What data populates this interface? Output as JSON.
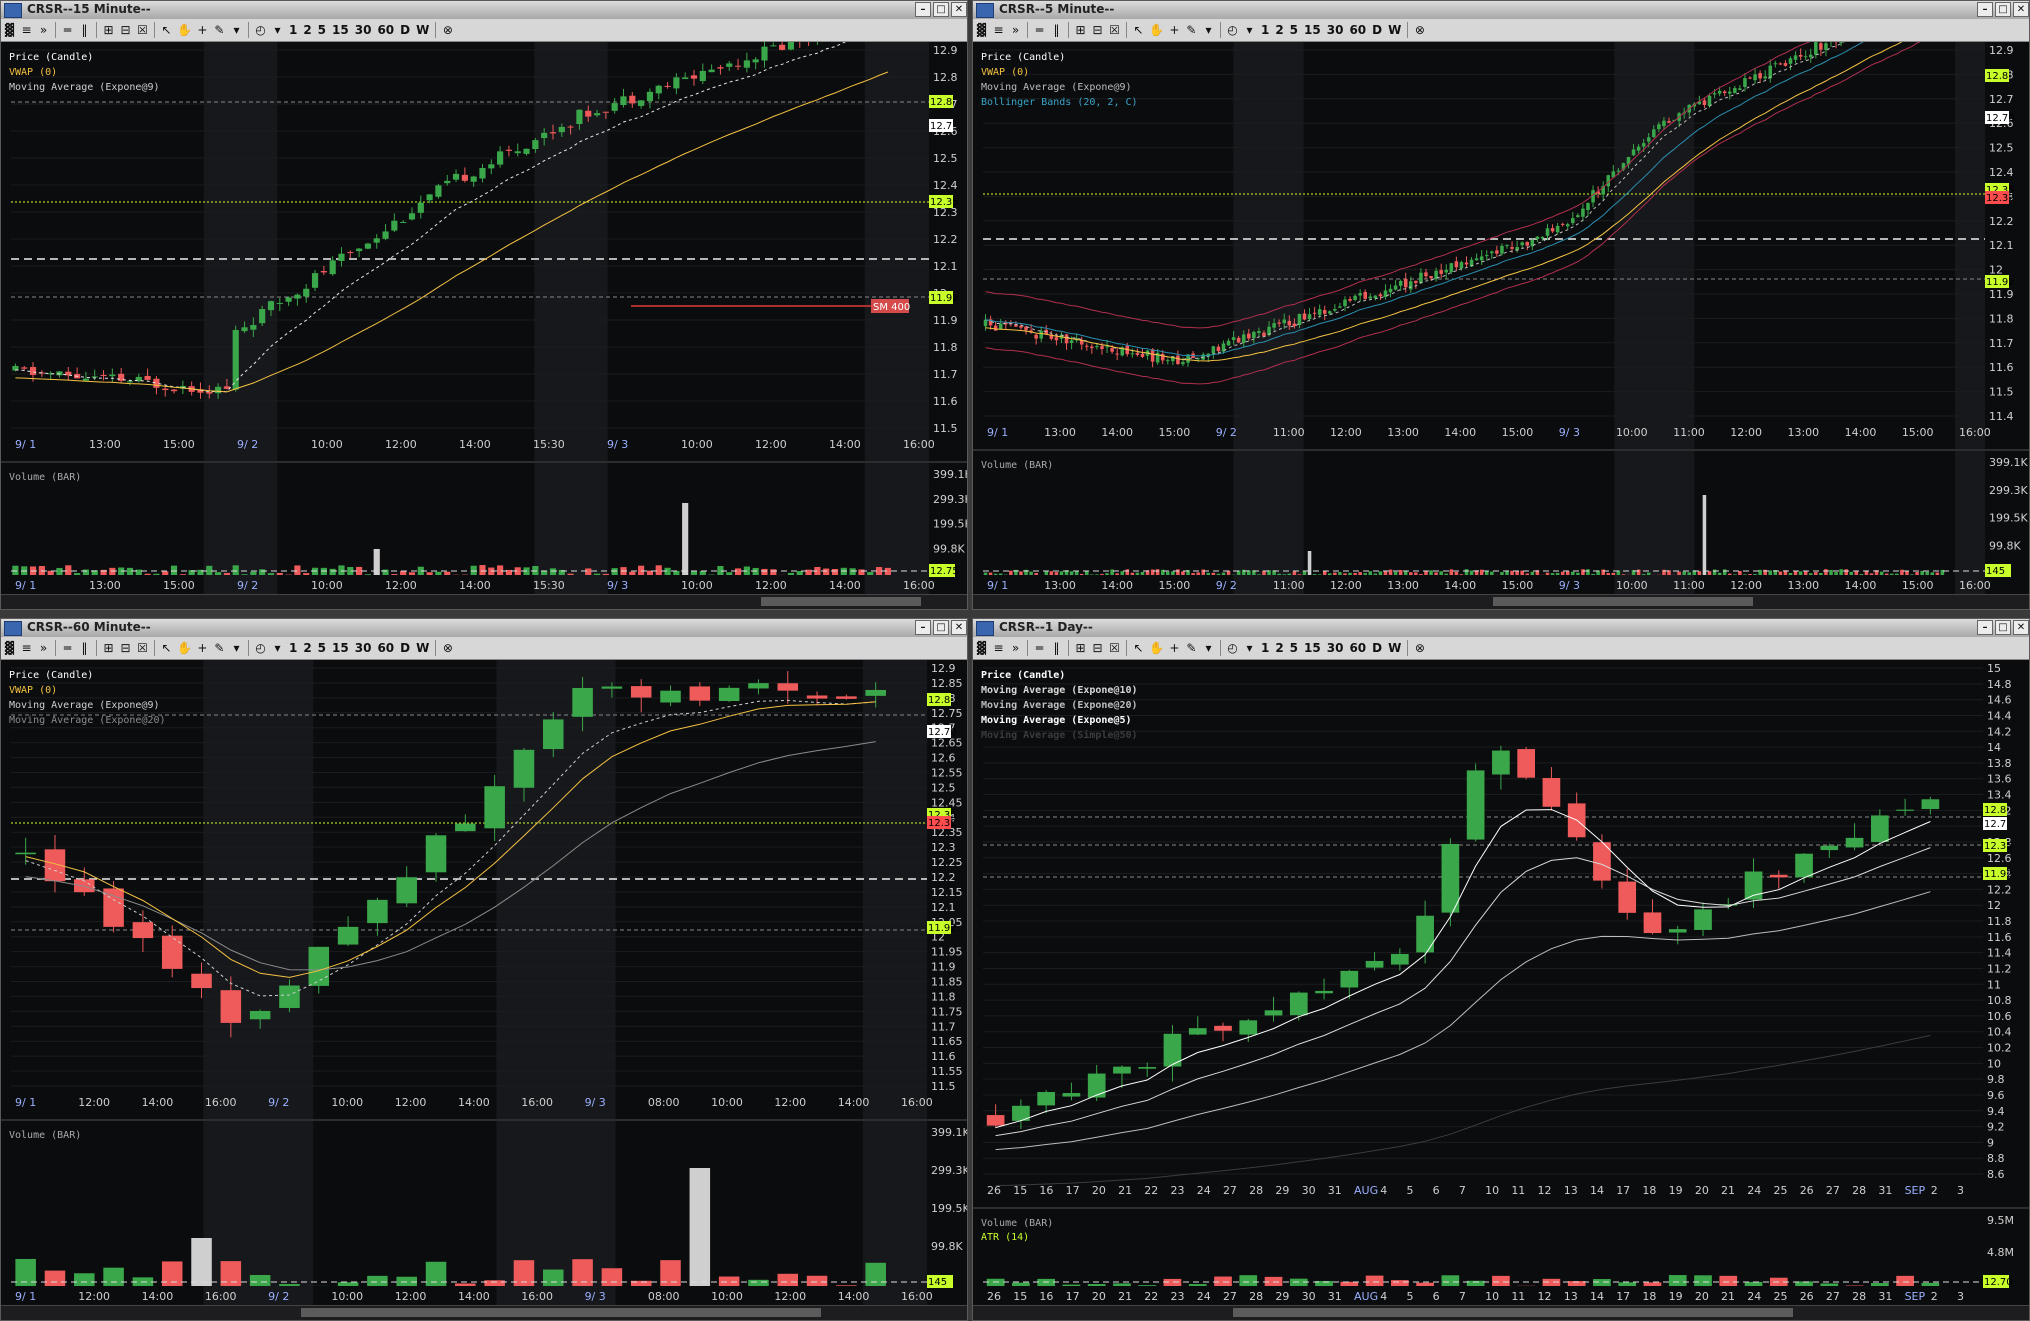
{
  "panels": [
    {
      "id": "p15",
      "title": "CRSR--15 Minute--",
      "legend": [
        {
          "text": "Price (Candle)",
          "color": "#ffffff"
        },
        {
          "text": "VWAP (0)",
          "color": "#f5c242"
        },
        {
          "text": "Moving Average (Expone@9)",
          "color": "#cfcfcf"
        }
      ],
      "price_ticks": [
        "12.9",
        "12.8",
        "12.7",
        "12.6",
        "12.5",
        "12.4",
        "12.3",
        "12.2",
        "12.1",
        "12",
        "11.9",
        "11.8",
        "11.7",
        "11.6",
        "11.5"
      ],
      "price_badges": [
        {
          "text": "12.8",
          "color": "#c8ff2a"
        },
        {
          "text": "12.7",
          "color": "#ffffff"
        },
        {
          "text": "12.35",
          "color": "#c8ff2a"
        },
        {
          "text": "11.92",
          "color": "#c8ff2a"
        }
      ],
      "order_label": "SM 400",
      "time_ticks": [
        "9/ 1",
        "13:00",
        "15:00",
        "9/ 2",
        "10:00",
        "12:00",
        "14:00",
        "15:30",
        "9/ 3",
        "10:00",
        "12:00",
        "14:00",
        "16:00"
      ],
      "volume_label": "Volume (BAR)",
      "volume_ticks": [
        "399.1K",
        "299.3K",
        "199.5K",
        "99.8K"
      ],
      "volume_badge": "12.75"
    },
    {
      "id": "p5",
      "title": "CRSR--5 Minute--",
      "legend": [
        {
          "text": "Price (Candle)",
          "color": "#ffffff"
        },
        {
          "text": "VWAP (0)",
          "color": "#f5c242"
        },
        {
          "text": "Moving Average (Expone@9)",
          "color": "#bdbdbd"
        },
        {
          "text": "Bollinger Bands (20, 2, C)",
          "color": "#3aa5c8"
        }
      ],
      "price_ticks": [
        "12.9",
        "12.8",
        "12.7",
        "12.6",
        "12.5",
        "12.4",
        "12.3",
        "12.2",
        "12.1",
        "12",
        "11.9",
        "11.8",
        "11.7",
        "11.6",
        "11.5",
        "11.4"
      ],
      "price_badges": [
        {
          "text": "12.8",
          "color": "#c8ff2a"
        },
        {
          "text": "12.70",
          "color": "#ffffff"
        },
        {
          "text": "12.35",
          "color": "#c8ff2a"
        },
        {
          "text": "12.32",
          "color": "#ff4d4d"
        },
        {
          "text": "11.92",
          "color": "#c8ff2a"
        }
      ],
      "time_ticks": [
        "9/ 1",
        "13:00",
        "14:00",
        "15:00",
        "9/ 2",
        "11:00",
        "12:00",
        "13:00",
        "14:00",
        "15:00",
        "9/ 3",
        "10:00",
        "11:00",
        "12:00",
        "13:00",
        "14:00",
        "15:00",
        "16:00"
      ],
      "volume_label": "Volume (BAR)",
      "volume_ticks": [
        "399.1K",
        "299.3K",
        "199.5K",
        "99.8K"
      ],
      "volume_badge": "145"
    },
    {
      "id": "p60",
      "title": "CRSR--60 Minute--",
      "legend": [
        {
          "text": "Price (Candle)",
          "color": "#ffffff"
        },
        {
          "text": "VWAP (0)",
          "color": "#f5c242"
        },
        {
          "text": "Moving Average (Expone@9)",
          "color": "#cfcfcf"
        },
        {
          "text": "Moving Average (Expone@20)",
          "color": "#8c8c8c"
        }
      ],
      "price_ticks": [
        "12.9",
        "12.85",
        "12.8",
        "12.75",
        "12.7",
        "12.65",
        "12.6",
        "12.55",
        "12.5",
        "12.45",
        "12.4",
        "12.35",
        "12.3",
        "12.25",
        "12.2",
        "12.15",
        "12.1",
        "12.05",
        "12",
        "11.95",
        "11.9",
        "11.85",
        "11.8",
        "11.75",
        "11.7",
        "11.65",
        "11.6",
        "11.55",
        "11.5"
      ],
      "price_badges": [
        {
          "text": "12.8",
          "color": "#c8ff2a"
        },
        {
          "text": "12.70",
          "color": "#ffffff"
        },
        {
          "text": "12.35",
          "color": "#c8ff2a"
        },
        {
          "text": "12.32",
          "color": "#ff4d4d"
        },
        {
          "text": "11.92",
          "color": "#c8ff2a"
        }
      ],
      "time_ticks": [
        "9/ 1",
        "12:00",
        "14:00",
        "16:00",
        "9/ 2",
        "10:00",
        "12:00",
        "14:00",
        "16:00",
        "9/ 3",
        "08:00",
        "10:00",
        "12:00",
        "14:00",
        "16:00"
      ],
      "volume_label": "Volume (BAR)",
      "volume_ticks": [
        "399.1K",
        "299.3K",
        "199.5K",
        "99.8K"
      ],
      "volume_badge": "145"
    },
    {
      "id": "p1d",
      "title": "CRSR--1 Day--",
      "legend": [
        {
          "text": "Price (Candle)",
          "color": "#ffffff"
        },
        {
          "text": "Moving Average (Expone@10)",
          "color": "#d8d8d8"
        },
        {
          "text": "Moving Average (Expone@20)",
          "color": "#bdbdbd"
        },
        {
          "text": "Moving Average (Expone@5)",
          "color": "#ffffff"
        },
        {
          "text": "Moving Average (Simple@50)",
          "color": "#3c3c3c"
        }
      ],
      "price_ticks": [
        "15",
        "14.8",
        "14.6",
        "14.4",
        "14.2",
        "14",
        "13.8",
        "13.6",
        "13.4",
        "13.2",
        "13",
        "12.8",
        "12.6",
        "12.4",
        "12.2",
        "12",
        "11.8",
        "11.6",
        "11.4",
        "11.2",
        "11",
        "10.8",
        "10.6",
        "10.4",
        "10.2",
        "10",
        "9.8",
        "9.6",
        "9.4",
        "9.2",
        "9",
        "8.8",
        "8.6"
      ],
      "price_badges": [
        {
          "text": "12.8",
          "color": "#c8ff2a"
        },
        {
          "text": "12.7",
          "color": "#ffffff"
        },
        {
          "text": "12.35",
          "color": "#c8ff2a"
        },
        {
          "text": "11.92",
          "color": "#c8ff2a"
        }
      ],
      "time_ticks": [
        "26",
        "15",
        "16",
        "17",
        "20",
        "21",
        "22",
        "23",
        "24",
        "27",
        "28",
        "29",
        "30",
        "31",
        "AUG",
        "4",
        "5",
        "6",
        "7",
        "10",
        "11",
        "12",
        "13",
        "14",
        "17",
        "18",
        "19",
        "20",
        "21",
        "24",
        "25",
        "26",
        "27",
        "28",
        "31",
        "SEP",
        "2",
        "3"
      ],
      "volume_label": "Volume (BAR)",
      "volume_sub": "ATR (14)",
      "volume_ticks": [
        "9.5M",
        "4.8M"
      ],
      "volume_badge": "12.70"
    }
  ],
  "toolbar": {
    "frames": [
      "1",
      "2",
      "5",
      "15",
      "30",
      "60",
      "D",
      "W"
    ]
  },
  "colors": {
    "up": "#3aa84a",
    "down": "#ef5a5a",
    "vwap": "#f5c242",
    "ma": "#e6e6e6",
    "grid": "#1b1c1f",
    "session": "#17181b"
  }
}
